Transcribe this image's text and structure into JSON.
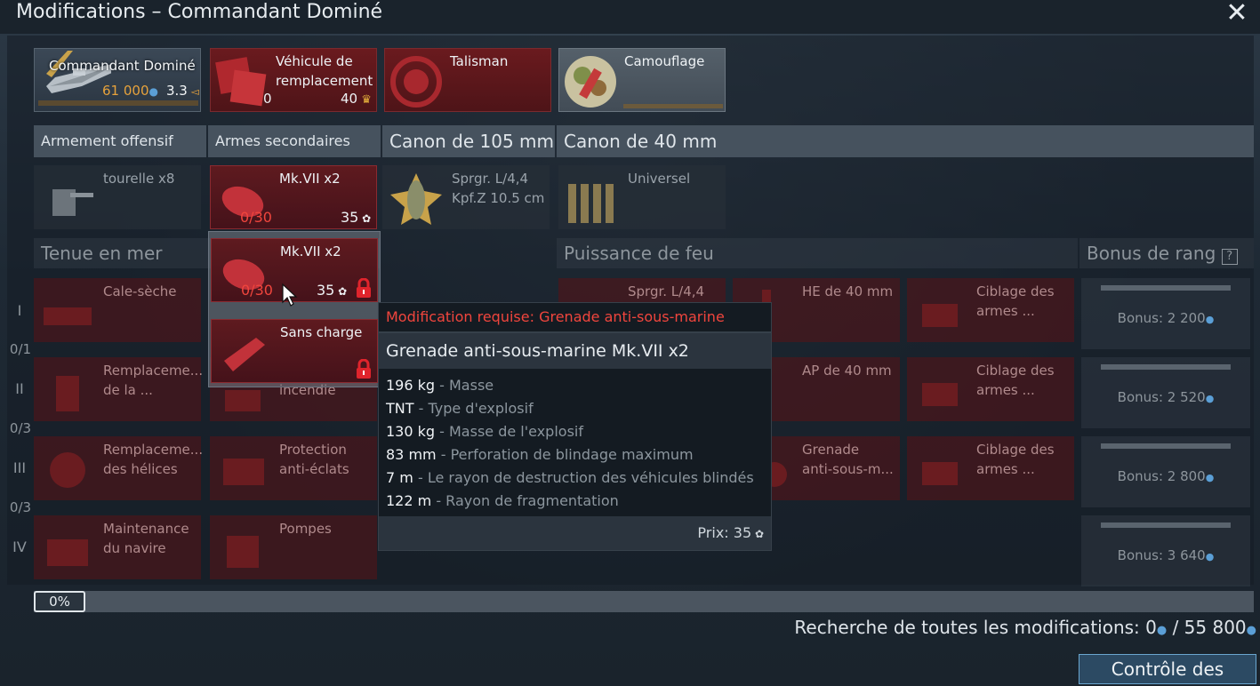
{
  "window": {
    "title": "Modifications – Commandant Dominé"
  },
  "top_cards": {
    "commander": {
      "name": "Commandant Dominé",
      "price": "61 000",
      "br": "3.3"
    },
    "replacement": {
      "label_line1": "Véhicule de",
      "label_line2": "remplacement",
      "count": "0",
      "cost": "40"
    },
    "talisman": {
      "label": "Talisman"
    },
    "camouflage": {
      "label": "Camouflage"
    }
  },
  "categories": {
    "offensive": "Armement offensif",
    "secondary": "Armes secondaires",
    "gun105": "Canon de 105 mm",
    "gun40": "Canon de 40 mm"
  },
  "weapons_row": {
    "turret": "tourelle x8",
    "mk7_label": "Mk.VII x2",
    "mk7_progress": "0/30",
    "mk7_cost": "35",
    "shell_line1": "Sprgr. L/4,4",
    "shell_line2": "Kpf.Z 10.5 cm",
    "universal": "Universel"
  },
  "sections": {
    "seakeeping": "Tenue en mer",
    "firepower": "Puissance de feu",
    "rank_bonus": "Bonus de rang",
    "help": "?"
  },
  "ranks": [
    "I",
    "II",
    "III",
    "IV"
  ],
  "rank_counts": [
    "0/1",
    "0/3",
    "0/3"
  ],
  "seakeeping_mods": {
    "r1": "Cale-sèche",
    "r2_line1": "Remplaceme...",
    "r2_line2": "de la ...",
    "r3_line1": "Remplaceme...",
    "r3_line2": "des hélices",
    "r4_line1": "Maintenance",
    "r4_line2": "du navire"
  },
  "secondary_mods": {
    "r2_partial": "incendie",
    "r3_line1": "Protection",
    "r3_line2": "anti-éclats",
    "r4": "Pompes"
  },
  "firepower_mods": {
    "r1_a": "Sprgr. L/4,4",
    "r1_b": "HE de 40 mm",
    "r1_c_line1": "Ciblage des",
    "r1_c_line2": "armes ...",
    "r2_b": "AP de 40 mm",
    "r2_c_line1": "Ciblage des",
    "r2_c_line2": "armes ...",
    "r3_b_line1": "Grenade",
    "r3_b_line2": "anti-sous-m...",
    "r3_c_line1": "Ciblage des",
    "r3_c_line2": "armes ..."
  },
  "bonuses": [
    "Bonus: 2 200",
    "Bonus: 2 520",
    "Bonus: 2 800",
    "Bonus: 3 640"
  ],
  "dropdown": {
    "item1_label": "Mk.VII x2",
    "item1_progress": "0/30",
    "item1_cost": "35",
    "item2_label": "Sans charge"
  },
  "tooltip": {
    "required": "Modification requise: Grenade anti-sous-marine",
    "title": "Grenade anti-sous-marine Mk.VII x2",
    "stats": [
      {
        "value": "196 kg",
        "label": "- Masse"
      },
      {
        "value": "TNT",
        "label": "- Type d'explosif"
      },
      {
        "value": "130 kg",
        "label": "- Masse de l'explosif"
      },
      {
        "value": "83 mm",
        "label": "- Perforation de blindage maximum"
      },
      {
        "value": "7 m",
        "label": "- Le rayon de destruction des véhicules blindés"
      },
      {
        "value": "122 m",
        "label": "- Rayon de fragmentation"
      }
    ],
    "price": "Prix: 35"
  },
  "footer": {
    "progress": "0%",
    "research_label": "Recherche de toutes les modifications: 0",
    "research_total": " / 55 800",
    "damage_control": "Contrôle des avaries"
  },
  "colors": {
    "accent_red": "#f0453d",
    "button_border": "#6aa6cf",
    "lock_red": "#e0242c"
  }
}
